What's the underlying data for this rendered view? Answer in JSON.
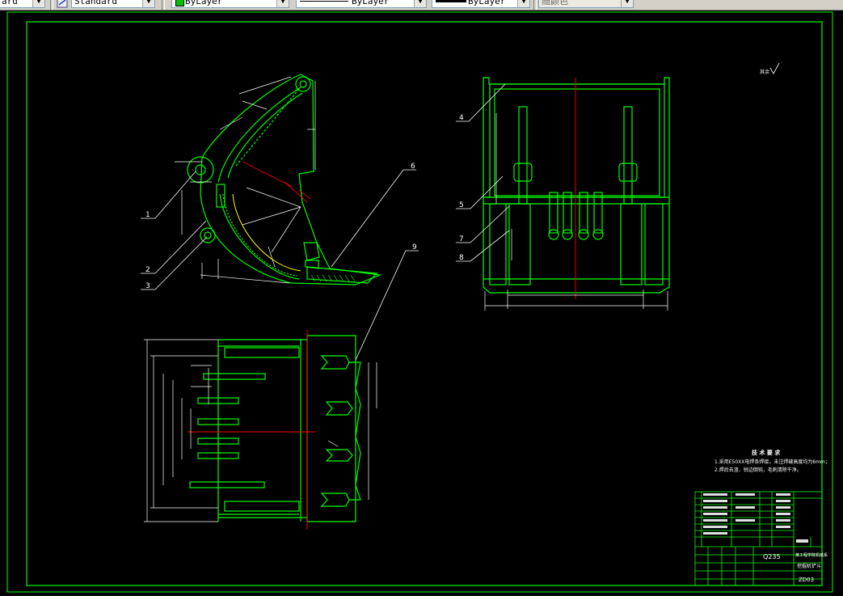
{
  "toolbar": {
    "textstyle": "ard",
    "dimstyle": "Standard",
    "color": "ByLayer",
    "color_swatch": "#00c000",
    "linetype": "ByLayer",
    "lineweight": "ByLayer",
    "plotstyle": "随颜色"
  },
  "drawing": {
    "balloons": [
      "1",
      "2",
      "3",
      "4",
      "5",
      "6",
      "7",
      "8",
      "9"
    ],
    "roughness_mark": "其余",
    "tech_title": "技 术 要 求",
    "tech_note_1": "1.采用E50XX电焊条焊接，未注焊缝高度均为6mm；",
    "tech_note_2": "2.焊后去渣、锐边倒钝，毛刺清除干净。",
    "title_material": "Q235",
    "title_drawing_no": "ZD03",
    "title_name": "挖掘机铲斗",
    "title_school": "某工程学院机械系"
  },
  "colors": {
    "line": "#00ff00",
    "centerline": "#ff0000",
    "dimension": "#ffffff",
    "frame": "#00ff00",
    "yellow": "#ffff00"
  }
}
